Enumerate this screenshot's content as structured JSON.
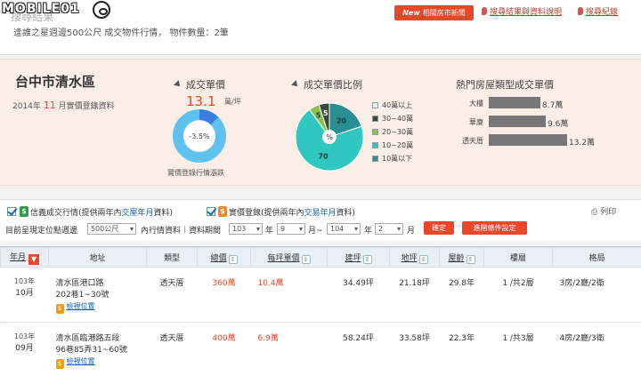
{
  "watermark": "MOBILE01",
  "top": {
    "faded_title": "搜尋結果",
    "news_button": {
      "new": "New",
      "label": "相關房市新聞"
    },
    "links": [
      "搜尋結果與資料說明",
      "搜尋紀錄"
    ],
    "summary": "逢誰之星週邊500公尺 成交物件行情， 物件數量：2筆"
  },
  "stats": {
    "district": "台中市清水區",
    "period": {
      "year_label": "2014年",
      "month": "11",
      "suffix": "月實價登錄資料"
    },
    "unit_price": {
      "title": "成交單價",
      "value": "13.1",
      "unit": "萬/坪",
      "change": "-3.5%",
      "caption": "實價登錄行情漲跌"
    },
    "ratio": {
      "title": "成交單價比例",
      "legend": [
        {
          "label": "40萬以上",
          "color": "#e8f1ec"
        },
        {
          "label": "30~40萬",
          "color": "#3a4a38"
        },
        {
          "label": "20~30萬",
          "color": "#8bc34a"
        },
        {
          "label": "10~20萬",
          "color": "#2fc7c0"
        },
        {
          "label": "10萬以下",
          "color": "#2a8f92"
        }
      ],
      "slices": [
        {
          "label": "20",
          "value": 20,
          "color": "#2a8f92"
        },
        {
          "label": "70",
          "value": 70,
          "color": "#2fc7c0"
        },
        {
          "label": "5",
          "value": 5,
          "color": "#8bc34a"
        },
        {
          "label": "5",
          "value": 5,
          "color": "#3a4a38"
        }
      ],
      "center": "%"
    },
    "popular": {
      "title": "熱門房屋類型成交單價",
      "items": [
        {
          "label": "大樓",
          "value": 8.7,
          "text": "8.7萬"
        },
        {
          "label": "華廈",
          "value": 9.6,
          "text": "9.6萬"
        },
        {
          "label": "透天厝",
          "value": 13.2,
          "text": "13.2萬"
        }
      ]
    }
  },
  "filters": {
    "source1": {
      "badge": "$",
      "pre": "信義成交行情(提供兩年內",
      "blue": "交屋年月",
      "post": "資料)"
    },
    "source2": {
      "badge": "$",
      "pre": "實價登錄(提供兩年內",
      "blue": "交易年月",
      "post": "資料)"
    },
    "print": "列印",
    "line2": {
      "prefix": "目前呈現定位點週邊",
      "distance": "500公尺",
      "mid": "內行情資料｜資料期間",
      "from_year": "103",
      "year1": "年",
      "from_month": "9",
      "month_to": "月~",
      "to_year": "104",
      "year2": "年",
      "to_month": "2",
      "month2": "月",
      "confirm": "確定",
      "advanced": "進階條件設定"
    }
  },
  "table": {
    "headers": [
      "年月",
      "地址",
      "類型",
      "總價",
      "每坪單價",
      "建坪",
      "地坪",
      "屋齡",
      "樓層",
      "格局"
    ],
    "rows": [
      {
        "year": "103年",
        "month": "10月",
        "addr1": "清水區港口路",
        "addr2": "202巷1~30號",
        "map": "檢視位置",
        "type": "透天厝",
        "total": "360萬",
        "unit": "10.4萬",
        "building": "34.49坪",
        "land": "21.18坪",
        "age": "29.8年",
        "floor": "1 /共2層",
        "layout": "3房/2廳/2衛"
      },
      {
        "year": "103年",
        "month": "09月",
        "addr1": "清水區臨港路五段",
        "addr2": "96巷85弄31~60號",
        "map": "檢視位置",
        "type": "透天厝",
        "total": "400萬",
        "unit": "6.9萬",
        "building": "58.24坪",
        "land": "33.58坪",
        "age": "22.3年",
        "floor": "1 /共3層",
        "layout": "4房/2廳/3衛"
      }
    ]
  }
}
